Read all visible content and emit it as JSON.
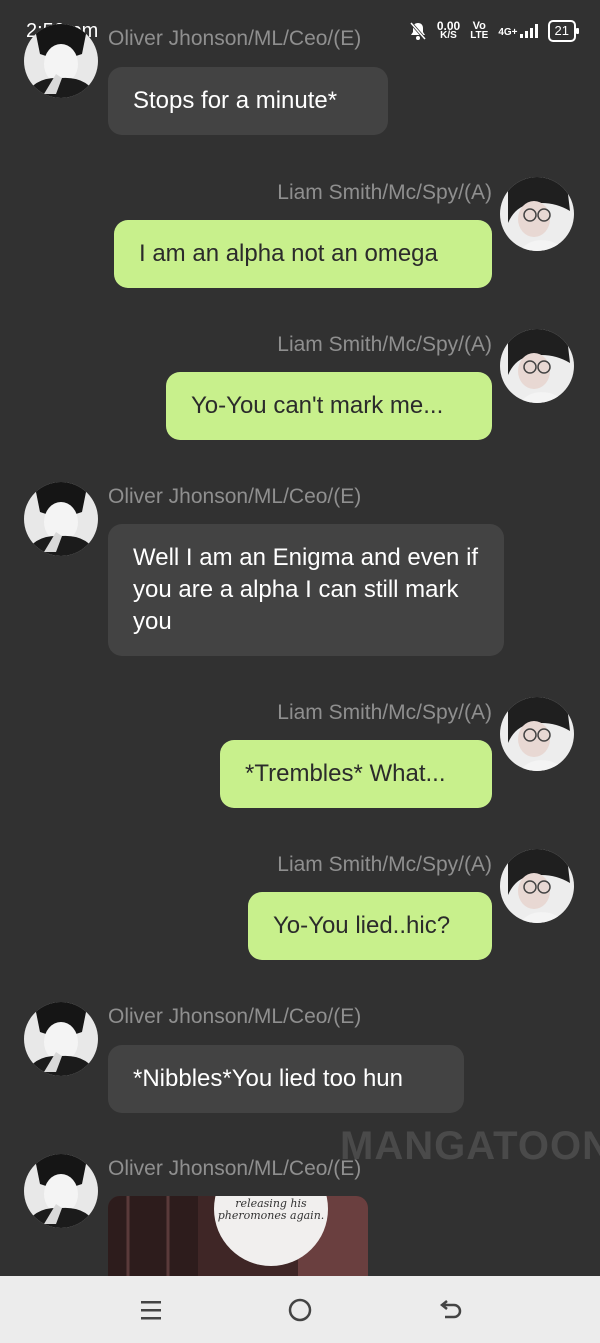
{
  "status_bar": {
    "time": "2:50 pm",
    "net_speed": "0.00",
    "net_unit": "K/S",
    "volte": "Vo",
    "lte": "LTE",
    "network": "4G+",
    "battery": "21"
  },
  "messages": [
    {
      "side": "left",
      "sender": "Oliver Jhonson/ML/Ceo/(E)",
      "text": "Stops for a minute*"
    },
    {
      "side": "right",
      "sender": "Liam Smith/Mc/Spy/(A)",
      "text": "I am an alpha not an omega"
    },
    {
      "side": "right",
      "sender": "Liam Smith/Mc/Spy/(A)",
      "text": "Yo-You can't mark me..."
    },
    {
      "side": "left",
      "sender": "Oliver Jhonson/ML/Ceo/(E)",
      "text": "Well I am an Enigma and even if you are a alpha I can still mark you"
    },
    {
      "side": "right",
      "sender": "Liam Smith/Mc/Spy/(A)",
      "text": "*Trembles* What..."
    },
    {
      "side": "right",
      "sender": "Liam Smith/Mc/Spy/(A)",
      "text": "Yo-You lied..hic?"
    },
    {
      "side": "left",
      "sender": "Oliver Jhonson/ML/Ceo/(E)",
      "text": "*Nibbles*You lied too hun"
    },
    {
      "side": "left",
      "sender": "Oliver Jhonson/ML/Ceo/(E)",
      "image_text": "releasing his pheromones again."
    }
  ],
  "watermark": "MANGATOON",
  "nav_bar": {
    "items": [
      "menu-icon",
      "home-icon",
      "back-icon"
    ]
  },
  "colors": {
    "background": "#313131",
    "left_bubble": "#434343",
    "right_bubble": "#c8f08c",
    "name_text": "#8f8f8f"
  }
}
